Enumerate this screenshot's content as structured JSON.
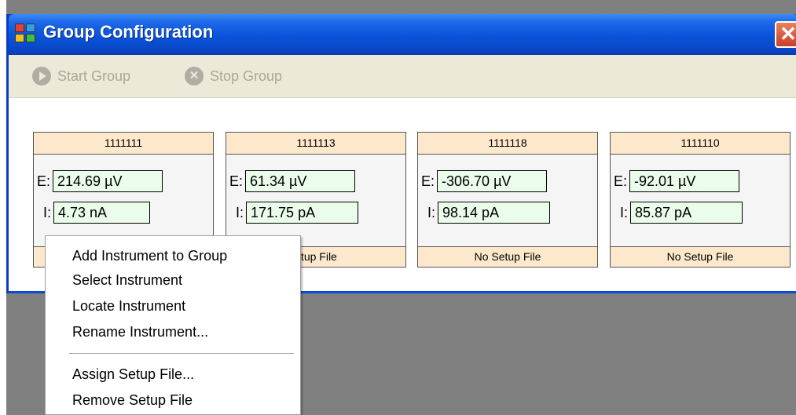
{
  "window": {
    "title": "Group Configuration",
    "close_glyph": "✕"
  },
  "toolbar": {
    "start_label": "Start Group",
    "start_icon": "play-icon",
    "stop_label": "Stop Group",
    "stop_icon": "stop-x-icon",
    "stop_glyph": "✕"
  },
  "instruments": [
    {
      "id": "1111111",
      "e_label": "E:",
      "e_value": "214.69 µV",
      "i_label": "I:",
      "i_value": "4.73 nA",
      "setup": ""
    },
    {
      "id": "1111113",
      "e_label": "E:",
      "e_value": "61.34 µV",
      "i_label": "I:",
      "i_value": "171.75 pA",
      "setup": "etup File"
    },
    {
      "id": "1111118",
      "e_label": "E:",
      "e_value": "-306.70 µV",
      "i_label": "I:",
      "i_value": "98.14 pA",
      "setup": "No Setup File"
    },
    {
      "id": "1111110",
      "e_label": "E:",
      "e_value": "-92.01 µV",
      "i_label": "I:",
      "i_value": "85.87 pA",
      "setup": "No Setup File"
    }
  ],
  "context_menu": {
    "items": [
      "Add Instrument to Group",
      "Select Instrument",
      "Locate Instrument",
      "Rename Instrument...",
      "Assign Setup File...",
      "Remove Setup File"
    ]
  },
  "colors": {
    "titlebar": "#0a55dc",
    "panel_header": "#fde8cc",
    "value_field": "#eafcea",
    "desktop": "#808080"
  }
}
